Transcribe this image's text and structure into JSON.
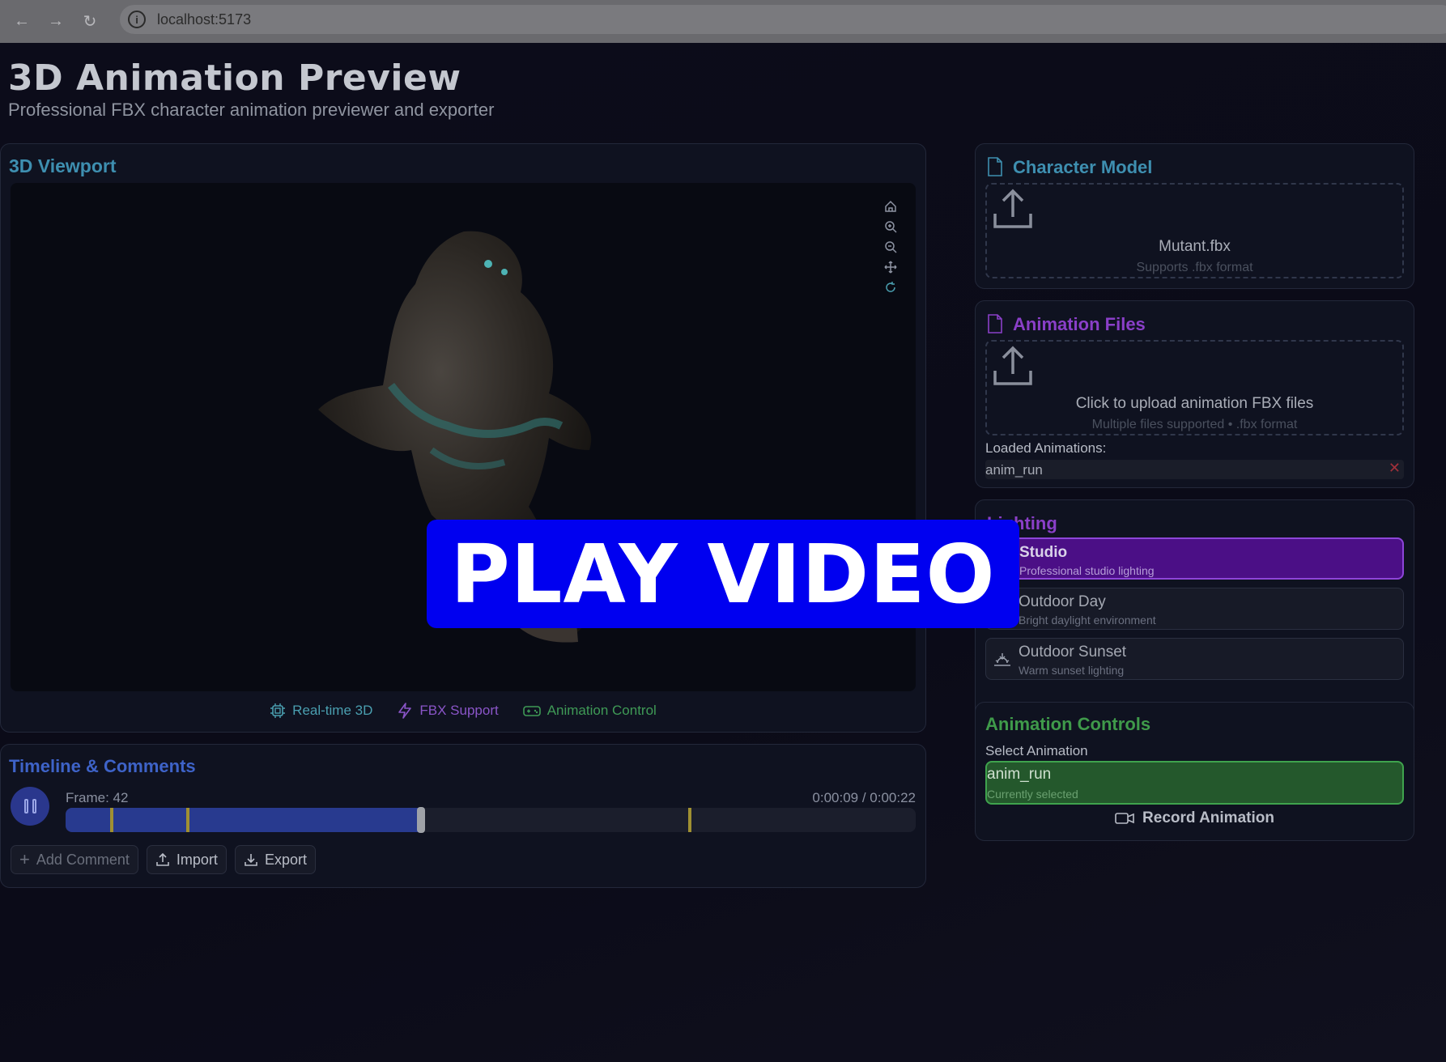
{
  "browser": {
    "url": "localhost:5173"
  },
  "header": {
    "title": "3D Animation Preview",
    "subtitle": "Professional FBX character animation previewer and exporter"
  },
  "viewport": {
    "title": "3D Viewport",
    "tools": [
      "home-icon",
      "zoom-in-icon",
      "zoom-out-icon",
      "move-icon",
      "rotate-icon"
    ],
    "features": [
      {
        "label": "Real-time 3D",
        "icon": "cpu-icon",
        "color": "#4a9fb0"
      },
      {
        "label": "FBX Support",
        "icon": "lightning-icon",
        "color": "#8a55c8"
      },
      {
        "label": "Animation Control",
        "icon": "gamepad-icon",
        "color": "#3f9a56"
      }
    ]
  },
  "timeline": {
    "title": "Timeline & Comments",
    "frame_label": "Frame: 42",
    "time_label": "0:00:09 / 0:00:22",
    "progress": 0.418,
    "markers": [
      0.052,
      0.142,
      0.732
    ],
    "actions": {
      "add_comment": "Add Comment",
      "import": "Import",
      "export": "Export"
    }
  },
  "character_model": {
    "title": "Character Model",
    "file_name": "Mutant.fbx",
    "hint": "Supports .fbx format"
  },
  "animation_files": {
    "title": "Animation Files",
    "upload_text": "Click to upload animation FBX files",
    "hint": "Multiple files supported • .fbx format",
    "loaded_label": "Loaded Animations:",
    "loaded": [
      "anim_run"
    ]
  },
  "lighting": {
    "title_visible": "ting",
    "options": [
      {
        "name": "Studio",
        "desc": "Professional studio lighting",
        "icon": "studio-icon",
        "active": true
      },
      {
        "name": "Outdoor Day",
        "desc": "Bright daylight environment",
        "icon": "sun-icon",
        "active": false
      },
      {
        "name": "Outdoor Sunset",
        "desc": "Warm sunset lighting",
        "icon": "sunset-icon",
        "active": false
      }
    ]
  },
  "animation_controls": {
    "title": "Animation Controls",
    "select_label": "Select Animation",
    "selected_name": "anim_run",
    "selected_hint": "Currently selected",
    "record_label": "Record Animation"
  },
  "overlay": {
    "label": "PLAY VIDEO"
  },
  "colors": {
    "viewport_title": "#3e8fb0",
    "timeline_title": "#3e63c8",
    "character_title": "#3e8fb0",
    "animation_title": "#8a3fc8",
    "controls_title": "#3f9a4a",
    "active_light": "#4b0f86",
    "selected_anim": "#24582c",
    "overlay": "#0000f0"
  }
}
